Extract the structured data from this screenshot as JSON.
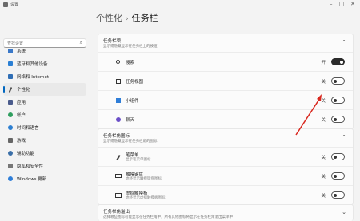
{
  "window": {
    "title": "设置"
  },
  "sidebar": {
    "search_placeholder": "查找设置",
    "items": [
      {
        "label": "系统",
        "color": "#3a78c8",
        "active": false
      },
      {
        "label": "蓝牙和其他设备",
        "color": "#2a7fd4",
        "active": false
      },
      {
        "label": "网络和 Internet",
        "color": "#2f6eb5",
        "active": false
      },
      {
        "label": "个性化",
        "color": "#555555",
        "active": true
      },
      {
        "label": "应用",
        "color": "#4a5b8c",
        "active": false
      },
      {
        "label": "帐户",
        "color": "#2f9e5f",
        "active": false
      },
      {
        "label": "时间和语言",
        "color": "#2d7fd1",
        "active": false
      },
      {
        "label": "游戏",
        "color": "#666666",
        "active": false
      },
      {
        "label": "辅助功能",
        "color": "#3b6fa8",
        "active": false
      },
      {
        "label": "隐私和安全性",
        "color": "#777777",
        "active": false
      },
      {
        "label": "Windows 更新",
        "color": "#2f7ed8",
        "active": false
      }
    ]
  },
  "header": {
    "crumb": "个性化",
    "separator": "›",
    "title": "任务栏"
  },
  "taskbar_items": {
    "title": "任务栏项",
    "subtitle": "显示或隐藏显示在任务栏上的按钮",
    "rows": [
      {
        "label": "搜索",
        "state": "开",
        "on": true,
        "icon": "search-icon"
      },
      {
        "label": "任务视图",
        "state": "关",
        "on": false,
        "icon": "task-view-icon"
      },
      {
        "label": "小组件",
        "state": "关",
        "on": false,
        "icon": "widgets-icon"
      },
      {
        "label": "聊天",
        "state": "关",
        "on": false,
        "icon": "chat-icon"
      }
    ]
  },
  "corner_icons": {
    "title": "任务栏角图标",
    "subtitle": "显示或隐藏显示在任务栏角的图标",
    "rows": [
      {
        "label": "笔菜单",
        "sub": "显示笔菜单图标",
        "state": "关",
        "on": false,
        "icon": "pen-icon"
      },
      {
        "label": "触摸键盘",
        "sub": "始终显示触摸键盘图标",
        "state": "关",
        "on": false,
        "icon": "keyboard-icon"
      },
      {
        "label": "虚拟触摸板",
        "sub": "始终显示虚拟触摸板图标",
        "state": "关",
        "on": false,
        "icon": "touchpad-icon"
      }
    ]
  },
  "overflow": {
    "title": "任务栏角溢出",
    "subtitle": "选择哪些图标可能显示在任务栏角中，所有其他图标将显示在任务栏角溢出菜单中"
  },
  "colors": {
    "accent": "#0067c0",
    "annotation_arrow": "#d9281f"
  }
}
